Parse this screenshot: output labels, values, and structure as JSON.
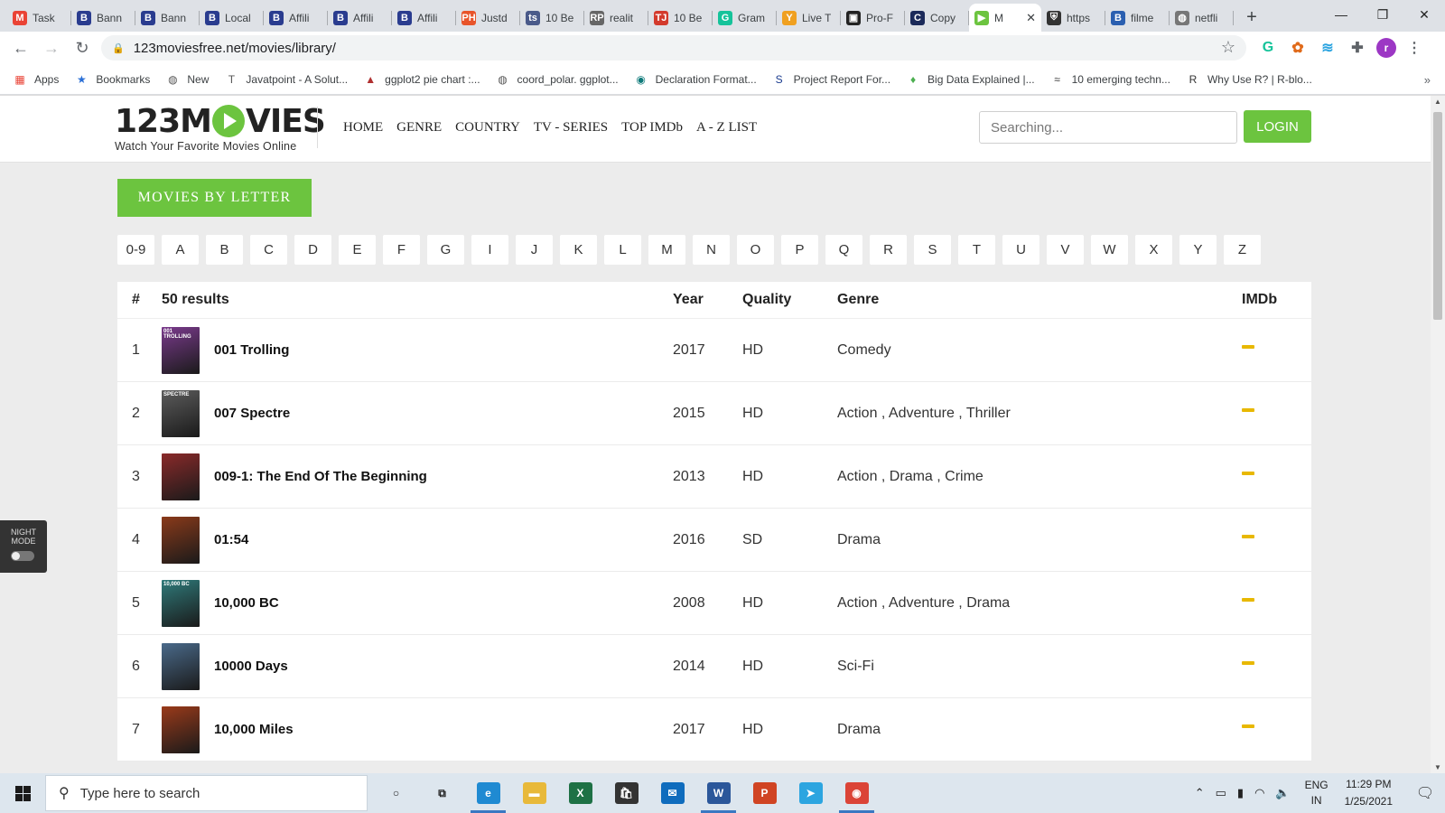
{
  "browser": {
    "tabs": [
      {
        "label": "Task",
        "icon": "gmail-icon",
        "fav": "M",
        "color": "#ea4335"
      },
      {
        "label": "Bann",
        "icon": "b-blog-icon",
        "fav": "B",
        "color": "#2a3c8f"
      },
      {
        "label": "Bann",
        "icon": "b-blog-icon",
        "fav": "B",
        "color": "#2a3c8f"
      },
      {
        "label": "Local",
        "icon": "b-blog-icon",
        "fav": "B",
        "color": "#2a3c8f"
      },
      {
        "label": "Affili",
        "icon": "b-blog-icon",
        "fav": "B",
        "color": "#2a3c8f"
      },
      {
        "label": "Affili",
        "icon": "b-blog-icon",
        "fav": "B",
        "color": "#2a3c8f"
      },
      {
        "label": "Affili",
        "icon": "b-blog-icon",
        "fav": "B",
        "color": "#2a3c8f"
      },
      {
        "label": "Justd",
        "icon": "ph-icon",
        "fav": "PH",
        "color": "#e8542a"
      },
      {
        "label": "10 Be",
        "icon": "ts-icon",
        "fav": "ts",
        "color": "#4a5a8a"
      },
      {
        "label": "realit",
        "icon": "rp-icon",
        "fav": "RP",
        "color": "#666666"
      },
      {
        "label": "10 Be",
        "icon": "tj-icon",
        "fav": "TJ",
        "color": "#d33a2c"
      },
      {
        "label": "Gram",
        "icon": "grammarly-icon",
        "fav": "G",
        "color": "#15c39a"
      },
      {
        "label": "Live T",
        "icon": "ycombinator-icon",
        "fav": "Y",
        "color": "#f0a020"
      },
      {
        "label": "Pro-F",
        "icon": "pro-icon",
        "fav": "▣",
        "color": "#222222"
      },
      {
        "label": "Copy",
        "icon": "c-icon",
        "fav": "C",
        "color": "#1b2a5a"
      },
      {
        "label": "M",
        "icon": "play-icon",
        "fav": "▶",
        "color": "#6cc43f",
        "active": true
      },
      {
        "label": "https",
        "icon": "shield-icon",
        "fav": "⛨",
        "color": "#333333"
      },
      {
        "label": "filme",
        "icon": "b-blog-icon",
        "fav": "B",
        "color": "#2a5fb0"
      },
      {
        "label": "netfli",
        "icon": "globe-icon",
        "fav": "◍",
        "color": "#777777"
      }
    ],
    "active_tab_close": "✕",
    "new_tab": "+",
    "window_controls": {
      "minimize": "—",
      "maximize": "❐",
      "close": "✕"
    },
    "address": "123moviesfree.net/movies/library/",
    "extensions": [
      {
        "icon": "grammarly-ext-icon",
        "glyph": "G",
        "color": "#15c39a"
      },
      {
        "icon": "flower-ext-icon",
        "glyph": "✿",
        "color": "#e06a1a"
      },
      {
        "icon": "wave-ext-icon",
        "glyph": "≋",
        "color": "#29a3e0"
      },
      {
        "icon": "puzzle-icon",
        "glyph": "✚",
        "color": "#5f6368"
      },
      {
        "icon": "profile-avatar",
        "glyph": "r",
        "color": "#9c37c4"
      },
      {
        "icon": "menu-dots-icon",
        "glyph": "⋮",
        "color": "#5f6368"
      }
    ],
    "bookmarks": [
      {
        "label": "Apps",
        "icon": "apps-grid-icon",
        "glyph": "▦",
        "color": "#e94235"
      },
      {
        "label": "Bookmarks",
        "icon": "star-icon",
        "glyph": "★",
        "color": "#2a6fd6"
      },
      {
        "label": "New",
        "icon": "globe-icon",
        "glyph": "◍",
        "color": "#555555"
      },
      {
        "label": "Javatpoint - A Solut...",
        "icon": "javatpoint-icon",
        "glyph": "T",
        "color": "#555555"
      },
      {
        "label": "ggplot2 pie chart :...",
        "icon": "warning-icon",
        "glyph": "▲",
        "color": "#b03030"
      },
      {
        "label": "coord_polar. ggplot...",
        "icon": "globe-icon",
        "glyph": "◍",
        "color": "#555555"
      },
      {
        "label": "Declaration Format...",
        "icon": "globe-icon",
        "glyph": "◉",
        "color": "#0f7a7a"
      },
      {
        "label": "Project Report For...",
        "icon": "s-icon",
        "glyph": "S",
        "color": "#1b3c8f"
      },
      {
        "label": "Big Data Explained |...",
        "icon": "leaf-icon",
        "glyph": "♦",
        "color": "#4caf50"
      },
      {
        "label": "10 emerging techn...",
        "icon": "wave-icon",
        "glyph": "≈",
        "color": "#333333"
      },
      {
        "label": "Why Use R? | R-blo...",
        "icon": "r-icon",
        "glyph": "R",
        "color": "#333333"
      }
    ],
    "bookmarks_more": "»"
  },
  "site": {
    "logo": {
      "left": "123M",
      "right": "VIES",
      "tagline": "Watch Your Favorite Movies Online"
    },
    "nav": [
      "HOME",
      "GENRE",
      "COUNTRY",
      "TV - SERIES",
      "TOP IMDb",
      "A - Z LIST"
    ],
    "search_placeholder": "Searching...",
    "login": "LOGIN",
    "section_title": "MOVIES BY LETTER",
    "letters": [
      "0-9",
      "A",
      "B",
      "C",
      "D",
      "E",
      "F",
      "G",
      "I",
      "J",
      "K",
      "L",
      "M",
      "N",
      "O",
      "P",
      "Q",
      "R",
      "S",
      "T",
      "U",
      "V",
      "W",
      "X",
      "Y",
      "Z"
    ],
    "table": {
      "headers": {
        "num": "#",
        "results": "50 results",
        "year": "Year",
        "quality": "Quality",
        "genre": "Genre",
        "imdb": "IMDb"
      },
      "rows": [
        {
          "num": "1",
          "title": "001 Trolling",
          "year": "2017",
          "quality": "HD",
          "genre": "Comedy",
          "poster_text": "001 TROLLING",
          "poster_color": "#7a3a8c"
        },
        {
          "num": "2",
          "title": "007 Spectre",
          "year": "2015",
          "quality": "HD",
          "genre": "Action , Adventure , Thriller",
          "poster_text": "SPECTRE",
          "poster_color": "#5c5c5c"
        },
        {
          "num": "3",
          "title": "009-1: The End Of The Beginning",
          "year": "2013",
          "quality": "HD",
          "genre": "Action , Drama , Crime",
          "poster_text": "",
          "poster_color": "#8a2a2a"
        },
        {
          "num": "4",
          "title": "01:54",
          "year": "2016",
          "quality": "SD",
          "genre": "Drama",
          "poster_text": "",
          "poster_color": "#8a3a1a"
        },
        {
          "num": "5",
          "title": "10,000 BC",
          "year": "2008",
          "quality": "HD",
          "genre": "Action , Adventure , Drama",
          "poster_text": "10,000 BC",
          "poster_color": "#2f7a7a"
        },
        {
          "num": "6",
          "title": "10000 Days",
          "year": "2014",
          "quality": "HD",
          "genre": "Sci-Fi",
          "poster_text": "",
          "poster_color": "#4a6a8a"
        },
        {
          "num": "7",
          "title": "10,000 Miles",
          "year": "2017",
          "quality": "HD",
          "genre": "Drama",
          "poster_text": "",
          "poster_color": "#9a3a1a"
        }
      ]
    },
    "night_mode": "NIGHT MODE"
  },
  "taskbar": {
    "search_placeholder": "Type here to search",
    "apps": [
      {
        "icon": "cortana-icon",
        "glyph": "○",
        "color": "transparent",
        "fg": "#222"
      },
      {
        "icon": "task-view-icon",
        "glyph": "⧉",
        "color": "transparent",
        "fg": "#222"
      },
      {
        "icon": "edge-icon",
        "glyph": "e",
        "color": "#1f8ad2",
        "fg": "#fff",
        "open": true
      },
      {
        "icon": "file-explorer-icon",
        "glyph": "▬",
        "color": "#e8b93a",
        "fg": "#fff"
      },
      {
        "icon": "excel-icon",
        "glyph": "X",
        "color": "#1e7145",
        "fg": "#fff"
      },
      {
        "icon": "store-icon",
        "glyph": "🛍",
        "color": "#333333",
        "fg": "#fff"
      },
      {
        "icon": "mail-icon",
        "glyph": "✉",
        "color": "#0f6cbd",
        "fg": "#fff"
      },
      {
        "icon": "word-icon",
        "glyph": "W",
        "color": "#2b579a",
        "fg": "#fff",
        "open": true
      },
      {
        "icon": "powerpoint-icon",
        "glyph": "P",
        "color": "#d04423",
        "fg": "#fff"
      },
      {
        "icon": "telegram-icon",
        "glyph": "➤",
        "color": "#2ca5e0",
        "fg": "#fff"
      },
      {
        "icon": "chrome-icon",
        "glyph": "◉",
        "color": "#db4437",
        "fg": "#fff",
        "open": true
      }
    ],
    "lang_top": "ENG",
    "lang_bottom": "IN",
    "time": "11:29 PM",
    "date": "1/25/2021"
  }
}
